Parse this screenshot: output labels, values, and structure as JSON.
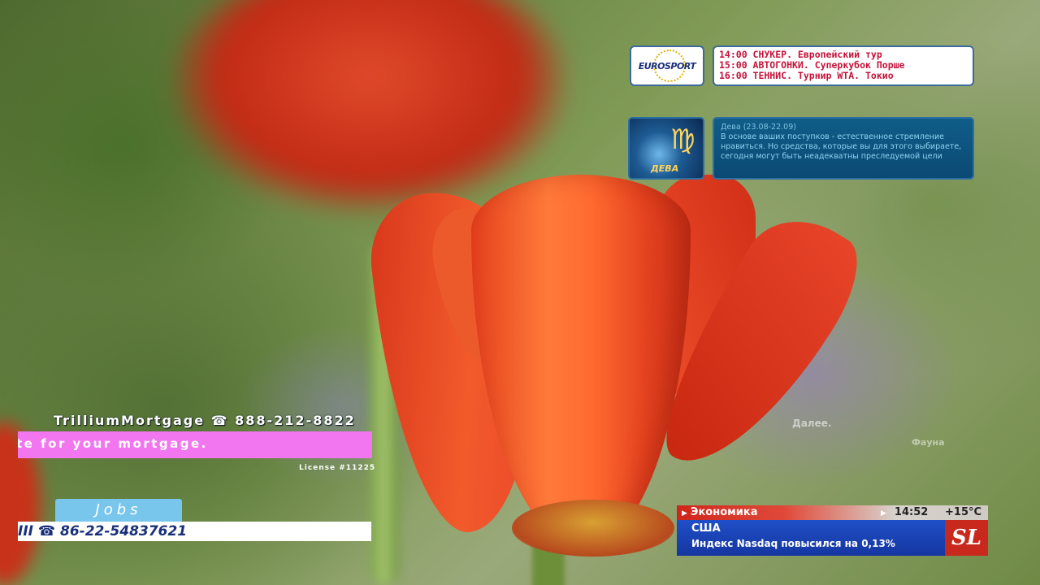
{
  "sports": {
    "logo_text": "EUROSPORT",
    "schedule": [
      "14:00 СНУКЕР. Европейский тур",
      "15:00 АВТОГОНКИ. Суперкубок Порше",
      "16:00 ТЕННИС. Турнир WTA. Токио"
    ]
  },
  "horoscope": {
    "image_label": "ДЕВА",
    "title": "Дева (23.08-22.09)",
    "text": "В основе ваших поступков - естественное стремление нравиться. Но средства, которые вы для этого выбираете, сегодня могут быть неадекватны преследуемой цели"
  },
  "labels": {
    "more": "Далее.",
    "fauna": "Фауна"
  },
  "mortgage": {
    "title": "TrilliumMortgage ☎ 888-212-8822",
    "ticker": "te for your mortgage.",
    "license": "License #11225"
  },
  "jobs": {
    "tab": "Jobs",
    "ticker": "III ☎ 86-22-54837621"
  },
  "news": {
    "category": "Экономика",
    "time": "14:52",
    "temperature": "+15°C",
    "country": "США",
    "headline": "Индекс Nasdaq повысился на 0,13%",
    "logo": "SL"
  },
  "colors": {
    "ticker_pink": "#f276f0",
    "jobs_blue": "#78c6ec",
    "news_red": "#d0251b",
    "news_blue": "#1f4fc8"
  },
  "icons": {
    "phone": "phone-icon",
    "zodiac": "virgo-icon"
  }
}
